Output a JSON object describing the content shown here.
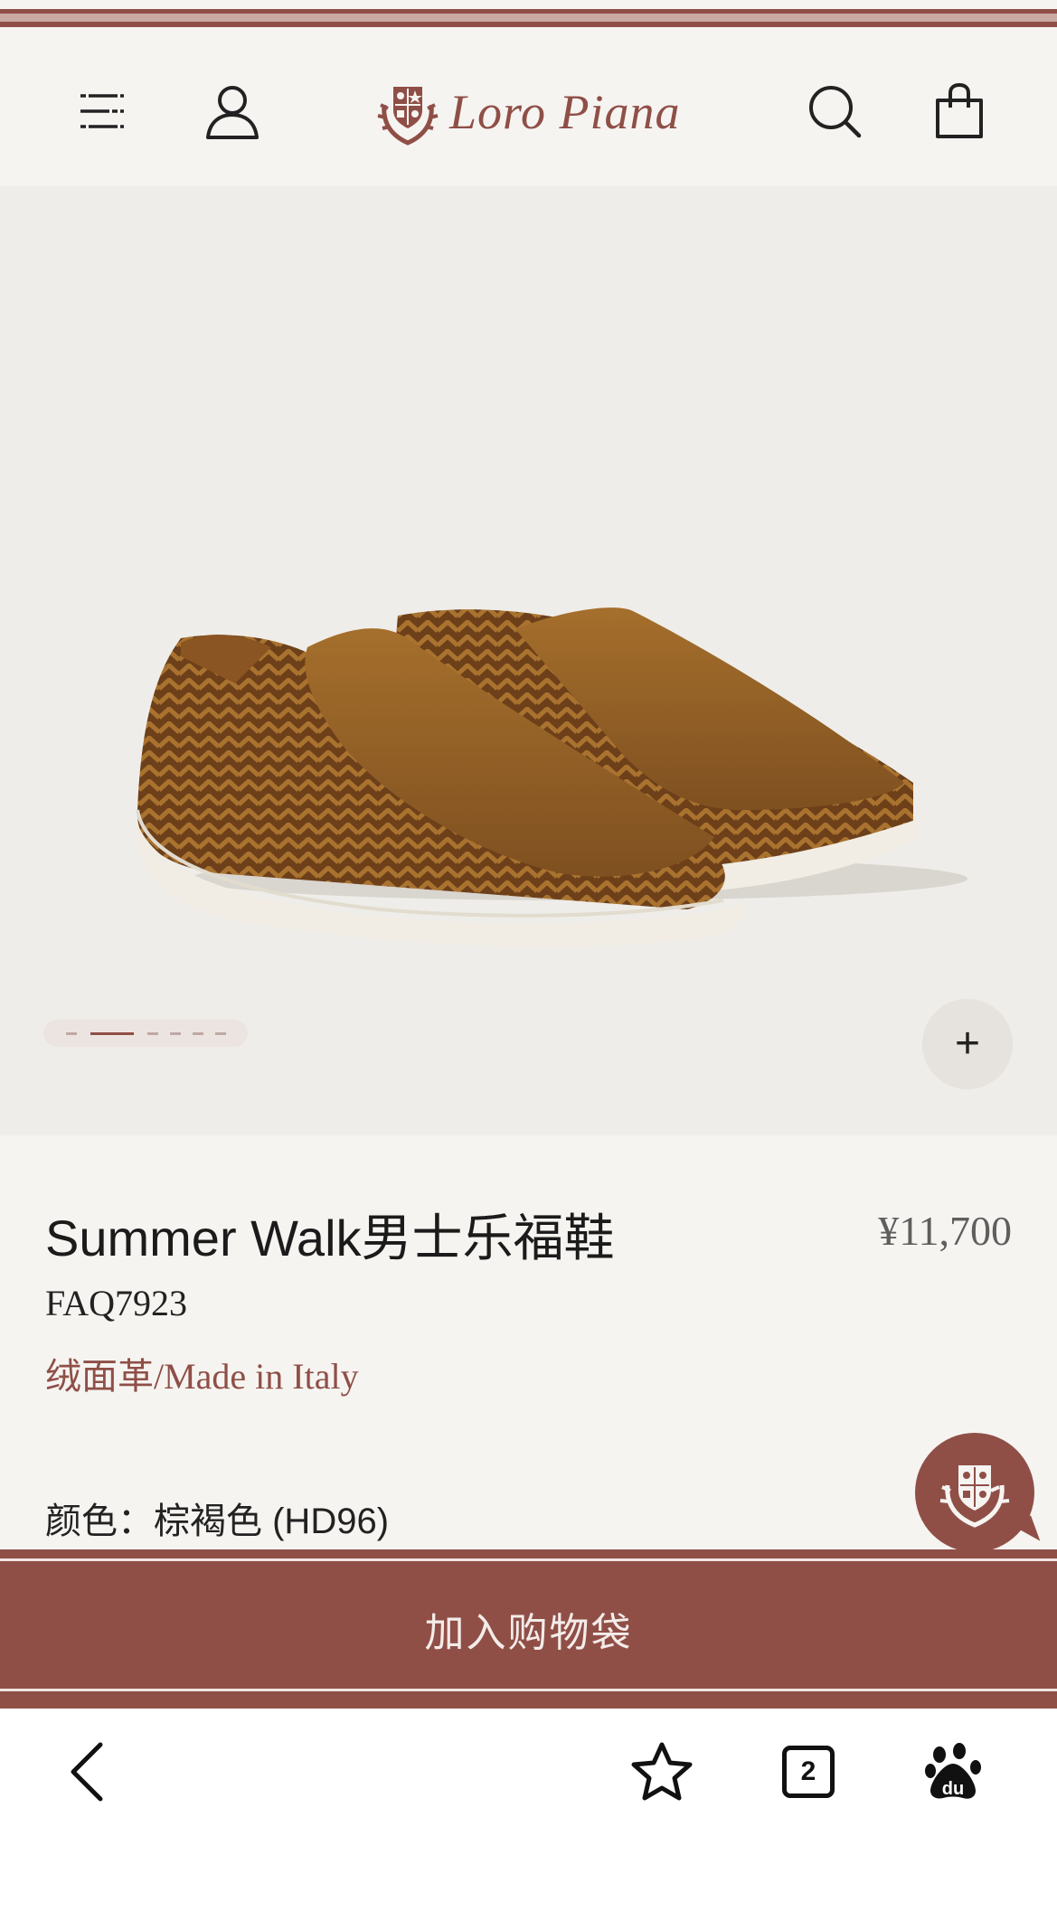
{
  "header": {
    "logo_text": "Loro Piana",
    "icons": [
      "menu-icon",
      "account-icon",
      "search-icon",
      "shopping-bag-icon"
    ]
  },
  "gallery": {
    "image_count": 7,
    "active_index": 1,
    "zoom_label": "+"
  },
  "product": {
    "title": "Summer Walk男士乐福鞋",
    "price": "¥11,700",
    "sku": "FAQ7923",
    "material": "绒面革/Made in Italy",
    "color_label": "颜色：",
    "color_value": "棕褐色 (HD96)"
  },
  "cart": {
    "add_label": "加入购物袋"
  },
  "browser": {
    "tab_count": "2",
    "icons": [
      "back-icon",
      "favorite-star-icon",
      "tabs-icon",
      "baidu-paw-icon"
    ]
  },
  "colors": {
    "brand": "#8f4f47",
    "background": "#f6f4f1",
    "hero_bg": "#efede9"
  }
}
